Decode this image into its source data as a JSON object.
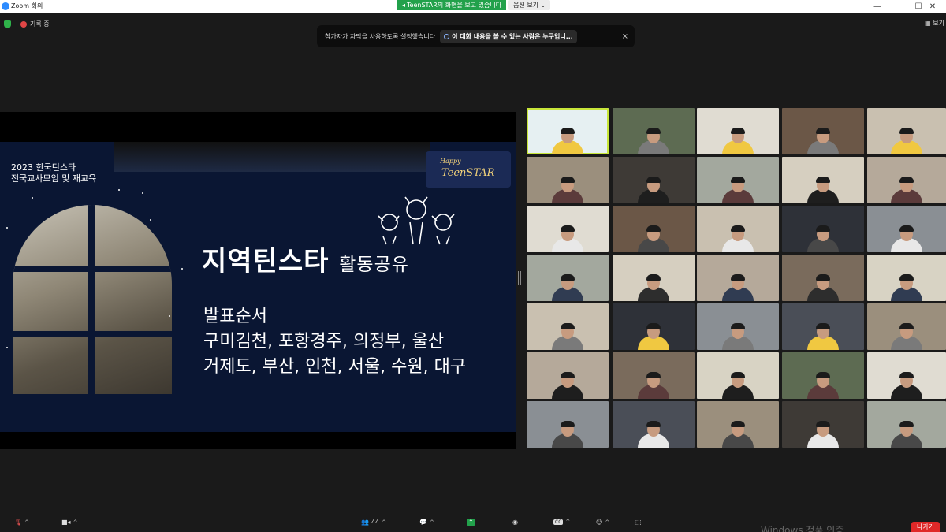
{
  "window": {
    "title": "Zoom 회의",
    "minimize": "—",
    "maximize": "☐",
    "close": "✕"
  },
  "share_banner": {
    "text": "TeenSTAR의 화면을 보고 있습니다",
    "options": "옵션 보기"
  },
  "status": {
    "recording_label": "기록 중",
    "view_label": "보기"
  },
  "caption_notice": {
    "text": "참가자가 자막을 사용하도록 설정했습니다",
    "link": "이 대화 내용을 볼 수 있는 사람은 누구입니...",
    "close": "×"
  },
  "slide": {
    "year_line1": "2023 한국틴스타",
    "year_line2": "전국교사모임 및 재교육",
    "logo_happy": "Happy",
    "logo_main": "TeenSTAR",
    "title_main": "지역틴스타 ",
    "title_sub": "활동공유",
    "order_heading": "발표순서",
    "order_line1": "구미김천, 포항경주, 의정부, 울산",
    "order_line2": "거제도, 부산, 인천, 서울, 수원, 대구"
  },
  "toolbar": {
    "participants_count": "44",
    "leave": "나가기"
  },
  "watermark": "Windows 정품 인증",
  "colors": {
    "accent_green": "#22a14b",
    "active_speaker": "#c8e63a",
    "leave_red": "#e02828",
    "slide_bg": "#0a1633"
  }
}
